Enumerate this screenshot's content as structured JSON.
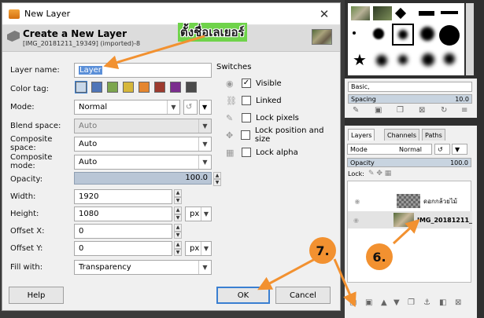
{
  "dialog": {
    "title": "New Layer",
    "close_glyph": "✕",
    "header_title": "Create a New Layer",
    "header_subtitle": "[IMG_20181211_19349] (imported)-8"
  },
  "form": {
    "layer_name_label": "Layer name:",
    "layer_name_value": "Layer",
    "color_tag_label": "Color tag:",
    "color_tags": [
      "#c8d8ea",
      "#4f75b8",
      "#7da64e",
      "#d6b73a",
      "#e5862f",
      "#9d3a2e",
      "#7b2d8e",
      "#4b4b4b"
    ],
    "mode_label": "Mode:",
    "mode_value": "Normal",
    "blend_space_label": "Blend space:",
    "blend_space_value": "Auto",
    "composite_space_label": "Composite space:",
    "composite_space_value": "Auto",
    "composite_mode_label": "Composite mode:",
    "composite_mode_value": "Auto",
    "opacity_label": "Opacity:",
    "opacity_value": "100.0",
    "width_label": "Width:",
    "width_value": "1920",
    "height_label": "Height:",
    "height_value": "1080",
    "unit_value": "px",
    "offset_x_label": "Offset X:",
    "offset_x_value": "0",
    "offset_y_label": "Offset Y:",
    "offset_y_value": "0",
    "offset_unit_value": "px",
    "fill_label": "Fill with:",
    "fill_value": "Transparency"
  },
  "switches": {
    "title": "Switches",
    "items": [
      {
        "label": "Visible",
        "checked": "✓",
        "icon": "eye-icon"
      },
      {
        "label": "Linked",
        "checked": "",
        "icon": "chain-icon"
      },
      {
        "label": "Lock pixels",
        "checked": "",
        "icon": "brush-icon"
      },
      {
        "label": "Lock position and size",
        "checked": "",
        "icon": "move-icon"
      },
      {
        "label": "Lock alpha",
        "checked": "",
        "icon": "checker-icon"
      }
    ]
  },
  "buttons": {
    "help": "Help",
    "ok": "OK",
    "cancel": "Cancel"
  },
  "annotation": {
    "thai_text": "ตั้งชื่อเลเยอร์",
    "step6": "6.",
    "step7": "7."
  },
  "dock": {
    "brush_preset": "Basic,",
    "spacing_label": "Spacing",
    "spacing_value": "10.0",
    "tabs": [
      "Layers",
      "Channels",
      "Paths"
    ],
    "mode_label": "Mode",
    "mode_value": "Normal",
    "opacity_label": "Opacity",
    "opacity_value": "100.0",
    "lock_label": "Lock:",
    "layers": [
      {
        "name": "ดอกกล้วยไม้",
        "bold": false
      },
      {
        "name": "IMG_20181211_",
        "bold": true
      }
    ]
  },
  "colors": {
    "accent": "#3a7fd1",
    "annotation_orange": "#f29130",
    "annotation_green": "#6fd34a"
  }
}
